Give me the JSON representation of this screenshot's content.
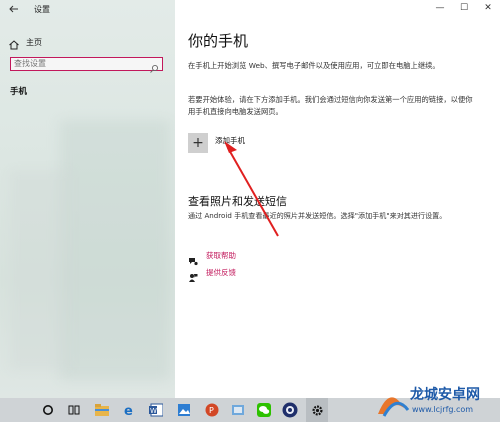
{
  "app": {
    "title": "设置",
    "back_icon": "back-arrow-icon"
  },
  "sidebar": {
    "home_label": "主页",
    "search_placeholder": "查找设置",
    "current_item": "手机",
    "accent_color": "#c2185b"
  },
  "window_controls": {
    "minimize": "—",
    "maximize": "☐",
    "close": "✕"
  },
  "main": {
    "title": "你的手机",
    "intro_1": "在手机上开始浏览 Web、撰写电子邮件以及使用应用，可立即在电脑上继续。",
    "intro_2": "若要开始体验，请在下方添加手机。我们会通过短信向你发送第一个应用的链接，以便你用手机直接向电脑发送网页。",
    "add_phone_label": "添加手机",
    "add_phone_symbol": "+",
    "section_title": "查看照片和发送短信",
    "section_text": "通过 Android 手机查看最近的照片并发送短信。选择\"添加手机\"来对其进行设置。",
    "links": [
      {
        "label": "获取帮助",
        "icon": "help-icon"
      },
      {
        "label": "提供反馈",
        "icon": "feedback-icon"
      }
    ]
  },
  "watermark": {
    "brand": "龙城安卓网",
    "url": "www.lcjrfg.com"
  },
  "taskbar": {
    "apps": [
      "cortana",
      "task-view",
      "file-explorer",
      "edge",
      "word",
      "photos",
      "powerpoint",
      "photo-viewer",
      "wechat",
      "app",
      "settings"
    ]
  }
}
